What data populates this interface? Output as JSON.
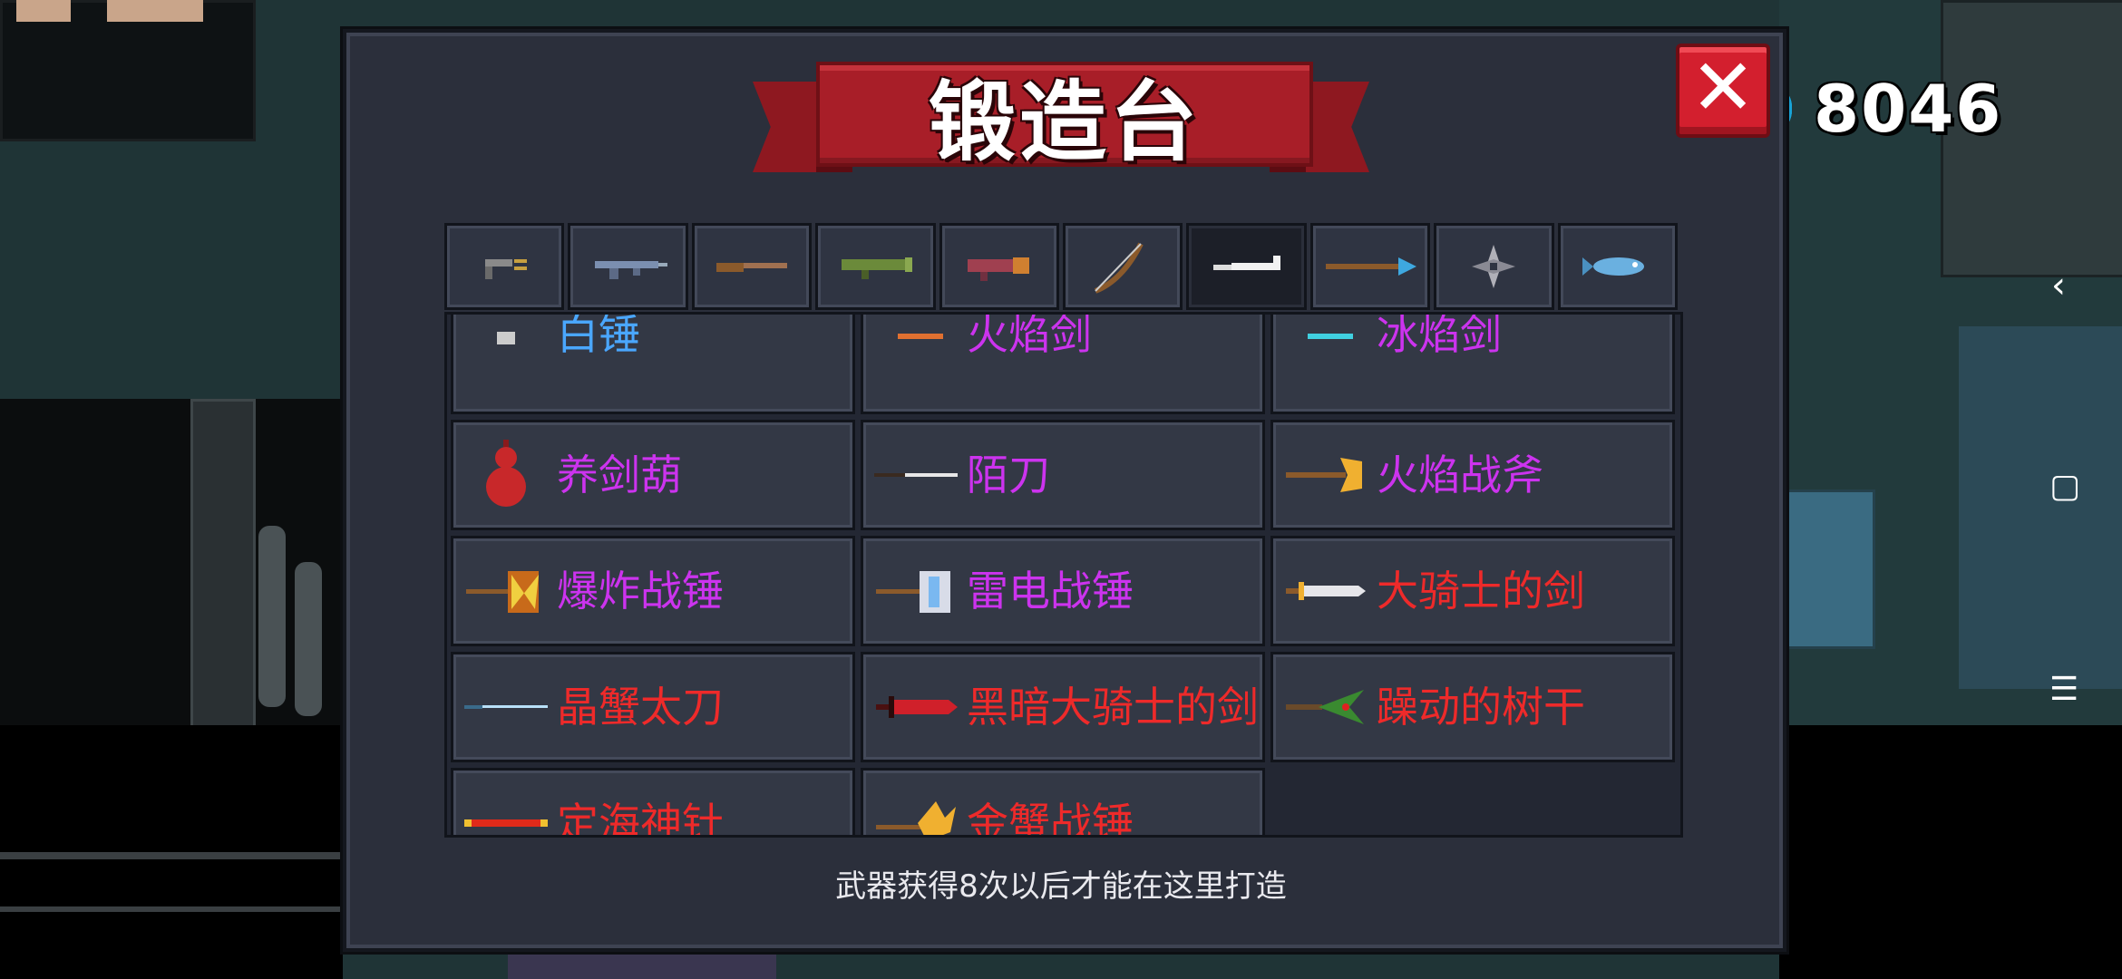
{
  "dialog": {
    "title": "锻造台",
    "close_label": "✕",
    "footer_note": "武器获得8次以后才能在这里打造"
  },
  "currency": {
    "value": "8046",
    "icon": "gem-icon",
    "color": "#2fd3ff"
  },
  "tabs": [
    {
      "name": "pistol",
      "icon": "pistol-icon",
      "active": false
    },
    {
      "name": "rifle",
      "icon": "rifle-icon",
      "active": false
    },
    {
      "name": "shotgun",
      "icon": "shotgun-icon",
      "active": false
    },
    {
      "name": "launcher",
      "icon": "launcher-icon",
      "active": false
    },
    {
      "name": "laser",
      "icon": "laser-gun-icon",
      "active": false
    },
    {
      "name": "bow",
      "icon": "bow-icon",
      "active": false
    },
    {
      "name": "blade",
      "icon": "blade-icon",
      "active": true
    },
    {
      "name": "spear",
      "icon": "spear-icon",
      "active": false
    },
    {
      "name": "throwing",
      "icon": "shuriken-icon",
      "active": false
    },
    {
      "name": "other",
      "icon": "fish-icon",
      "active": false
    }
  ],
  "weapons": [
    {
      "label": "白锤",
      "rarity": "blue",
      "icon": "hammer-icon",
      "partial": true
    },
    {
      "label": "火焰剑",
      "rarity": "purple",
      "icon": "fire-sword-icon",
      "partial": true
    },
    {
      "label": "冰焰剑",
      "rarity": "purple",
      "icon": "ice-sword-icon",
      "partial": true
    },
    {
      "label": "养剑葫",
      "rarity": "purple",
      "icon": "gourd-icon"
    },
    {
      "label": "陌刀",
      "rarity": "purple",
      "icon": "long-blade-icon"
    },
    {
      "label": "火焰战斧",
      "rarity": "purple",
      "icon": "battle-axe-icon"
    },
    {
      "label": "爆炸战锤",
      "rarity": "purple",
      "icon": "explosive-hammer-icon"
    },
    {
      "label": "雷电战锤",
      "rarity": "purple",
      "icon": "thunder-hammer-icon"
    },
    {
      "label": "大骑士的剑",
      "rarity": "red",
      "icon": "knight-sword-icon"
    },
    {
      "label": "晶蟹太刀",
      "rarity": "red",
      "icon": "crystal-katana-icon"
    },
    {
      "label": "黑暗大骑士的剑",
      "rarity": "red",
      "icon": "dark-knight-sword-icon"
    },
    {
      "label": "躁动的树干",
      "rarity": "red",
      "icon": "tree-trunk-icon"
    },
    {
      "label": "定海神针",
      "rarity": "red",
      "icon": "golden-staff-icon"
    },
    {
      "label": "金蟹战锤",
      "rarity": "red",
      "icon": "crab-hammer-icon"
    }
  ],
  "colors": {
    "blue": "#4aa7ff",
    "purple": "#cc33ee",
    "red": "#ee2a2a"
  },
  "system_nav": {
    "back": "‹",
    "home": "▢",
    "menu": "☰"
  }
}
